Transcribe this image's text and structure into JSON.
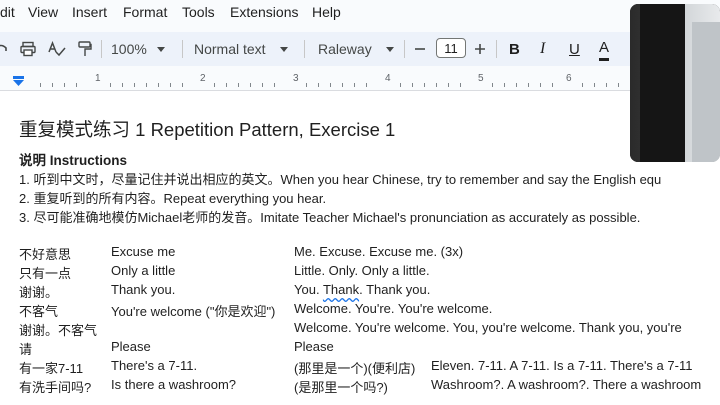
{
  "menu": [
    "dit",
    "View",
    "Insert",
    "Format",
    "Tools",
    "Extensions",
    "Help"
  ],
  "toolbar": {
    "zoom": "100%",
    "style": "Normal text",
    "font": "Raleway",
    "font_size": "11",
    "bold": "B",
    "italic": "I",
    "underline": "U",
    "text_color": "A"
  },
  "ruler": [
    "1",
    "2",
    "3",
    "4",
    "5",
    "6"
  ],
  "doc": {
    "title": "重复模式练习 1 Repetition Pattern, Exercise 1",
    "instructions_heading": "说明 Instructions",
    "instructions": [
      "1. 听到中文时，尽量记住并说出相应的英文。When you hear Chinese, try to remember and say the English equ",
      "2. 重复听到的所有内容。Repeat everything you hear.",
      "3. 尽可能准确地模仿Michael老师的发音。Imitate Teacher Michael's pronunciation as accurately as possible."
    ],
    "rows": [
      {
        "zh": "不好意思",
        "en": "Excuse me",
        "rep": "Me. Excuse. Excuse me. (3x)"
      },
      {
        "zh": "只有一点",
        "en": "Only a little",
        "rep": "Little. Only. Only a little."
      },
      {
        "zh": "谢谢。",
        "en": "Thank you.",
        "rep_a": "You. ",
        "rep_b": "Thank",
        "rep_c": ". Thank you."
      },
      {
        "zh": "不客气",
        "en": "You're welcome (\"你是欢迎\")",
        "rep": "Welcome. You're. You're welcome."
      },
      {
        "zh": "谢谢。不客气",
        "en": "",
        "rep": "Welcome. You're welcome. You, you're welcome. Thank you, you're"
      },
      {
        "zh": "请",
        "en": "Please",
        "rep": "Please"
      },
      {
        "zh": "有一家7-11",
        "en": "There's  a 7-11.",
        "mid": "(那里是一个)(便利店)",
        "rep": "Eleven. 7-11. A 7-11.  Is a 7-11. There's a 7-11"
      },
      {
        "zh": "有洗手间吗?",
        "en": "Is there a washroom?",
        "mid": "(是那里一个吗?)",
        "rep": "Washroom?. A washroom?. There a washroom"
      }
    ]
  }
}
